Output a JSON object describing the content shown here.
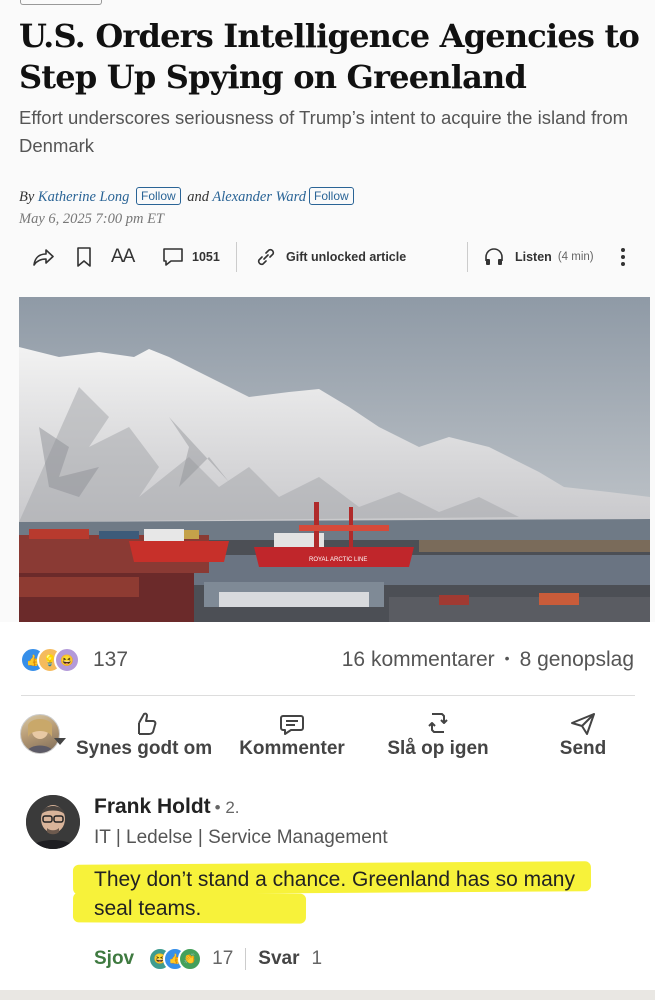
{
  "article": {
    "headline": "U.S. Orders Intelligence Agencies to Step Up Spying on Greenland",
    "dek": "Effort underscores seriousness of Trump’s intent to acquire the island from Denmark",
    "byline_prefix": "By",
    "author1": "Katherine Long",
    "follow_label": "Follow",
    "byline_and": "and",
    "author2": "Alexander Ward",
    "date": "May 6, 2025 7:00 pm ET",
    "toolbar": {
      "share_icon": "share-arrow-icon",
      "bookmark_icon": "bookmark-icon",
      "text_size_label": "AA",
      "comment_count": "1051",
      "gift_label": "Gift unlocked article",
      "listen_label": "Listen",
      "listen_duration": "(4 min)"
    },
    "photo_ship_text": "ROYAL ARCTIC LINE"
  },
  "post": {
    "reaction_count": "137",
    "comments": "16 kommentarer",
    "separator": "•",
    "reposts": "8 genopslag",
    "actions": {
      "like": "Synes godt om",
      "comment": "Kommenter",
      "repost": "Slå op igen",
      "send": "Send"
    }
  },
  "comment": {
    "author": "Frank Holdt",
    "degree": "• 2.",
    "headline": "IT | Ledelse | Service Management",
    "text": "They don’t stand a chance. Greenland has so many seal teams.",
    "reaction_label": "Sjov",
    "reaction_count": "17",
    "reply_label": "Svar",
    "reply_count": "1"
  },
  "colors": {
    "highlight": "#f7f23a",
    "link_blue": "#2a6496",
    "funny_green": "#3f7a40"
  }
}
